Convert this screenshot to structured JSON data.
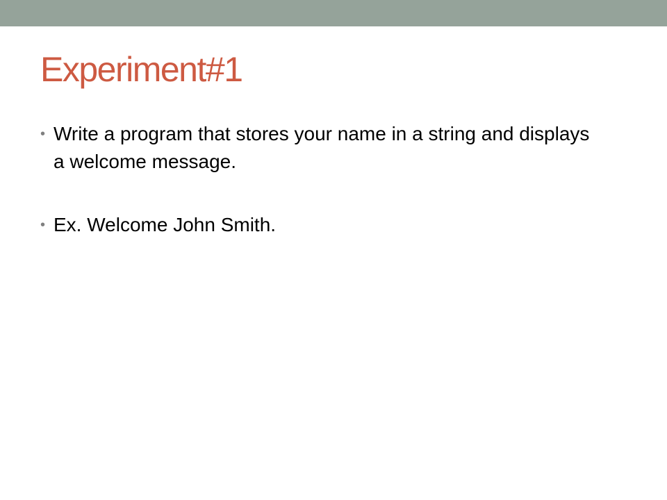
{
  "colors": {
    "top_bar": "#95a39a",
    "title": "#cd5a42",
    "body_text": "#000000",
    "bullet": "#808080"
  },
  "slide": {
    "title": "Experiment#1",
    "bullets": [
      "Write a program that stores your name in a string and displays a welcome message.",
      "Ex. Welcome John Smith."
    ],
    "bullet_glyph": "•"
  }
}
